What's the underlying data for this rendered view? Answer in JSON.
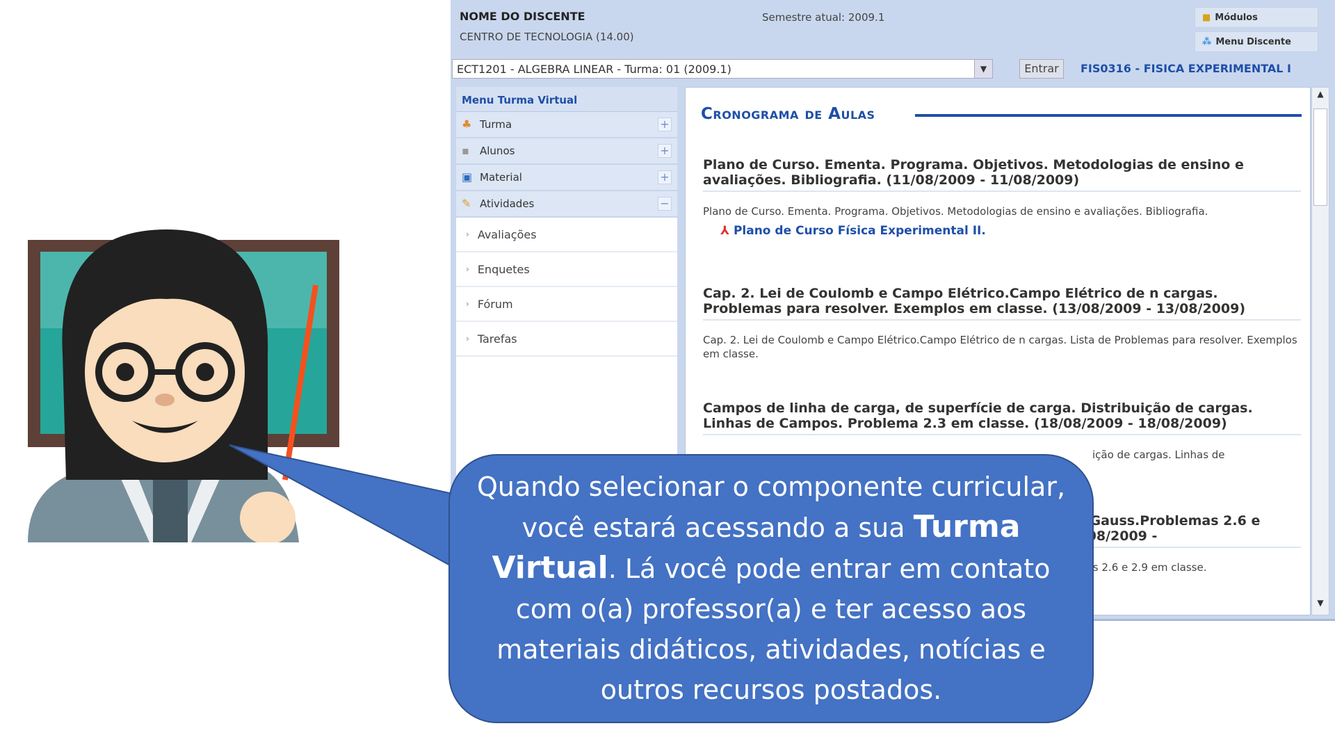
{
  "header": {
    "student_name": "NOME DO DISCENTE",
    "center": "CENTRO DE TECNOLOGIA (14.00)",
    "semester": "Semestre atual: 2009.1",
    "modules_button": "Módulos",
    "student_menu_button": "Menu Discente"
  },
  "course_select": {
    "value": "ECT1201 - ALGEBRA LINEAR - Turma: 01 (2009.1)",
    "enter_button": "Entrar",
    "current_course": "FIS0316 - FISICA EXPERIMENTAL I"
  },
  "sidebar": {
    "title": "Menu Turma Virtual",
    "groups": [
      {
        "label": "Turma",
        "icon": "users-icon",
        "toggle": "+"
      },
      {
        "label": "Alunos",
        "icon": "students-icon",
        "toggle": "+"
      },
      {
        "label": "Material",
        "icon": "book-icon",
        "toggle": "+"
      },
      {
        "label": "Atividades",
        "icon": "checklist-icon",
        "toggle": "−"
      }
    ],
    "subitems": [
      "Avaliações",
      "Enquetes",
      "Fórum",
      "Tarefas"
    ]
  },
  "content": {
    "title": "Cronograma de Aulas",
    "items": [
      {
        "heading": "Plano de Curso. Ementa. Programa. Objetivos. Metodologias de ensino e avaliações. Bibliografia. (11/08/2009 - 11/08/2009)",
        "text": "Plano de Curso. Ementa. Programa. Objetivos. Metodologias de ensino e avaliações. Bibliografia.",
        "link": "Plano de Curso Física Experimental II."
      },
      {
        "heading": "Cap. 2. Lei de Coulomb e Campo Elétrico.Campo Elétrico de n cargas. Problemas para resolver. Exemplos em classe. (13/08/2009 - 13/08/2009)",
        "text": "Cap. 2. Lei de Coulomb e Campo Elétrico.Campo Elétrico de n cargas. Lista de Problemas para resolver. Exemplos em classe."
      },
      {
        "heading": "Campos de linha de carga, de superfície de carga. Distribuição de cargas. Linhas de Campos. Problema 2.3 em classe. (18/08/2009 - 18/08/2009)",
        "text": "ição de cargas. Linhas de"
      },
      {
        "heading": "e Gauss.Problemas 2.6 e )/08/2009 -",
        "text": "mas 2.6 e 2.9 em classe."
      }
    ]
  },
  "callout": {
    "line1": "Quando selecionar o componente curricular, você estará acessando a sua",
    "bold": "Turma Virtual",
    "line2": ". Lá você pode entrar em contato com o(a) professor(a) e ter acesso aos materiais didáticos, atividades, notícias e outros recursos postados."
  },
  "colors": {
    "callout": "#4472c4",
    "link": "#1e4fa8",
    "header_bg": "#c9d7ee"
  }
}
